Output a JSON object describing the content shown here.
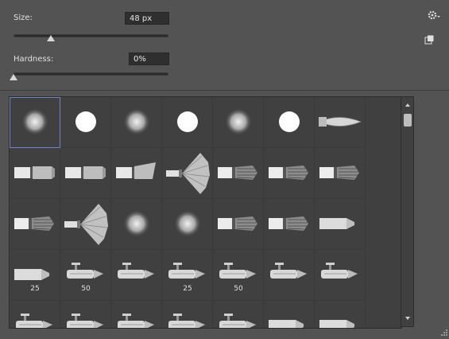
{
  "size": {
    "label": "Size:",
    "value": "48 px",
    "slider_fraction": 0.24
  },
  "hardness": {
    "label": "Hardness:",
    "value": "0%",
    "slider_fraction": 0.0
  },
  "icons": {
    "gear": "gear-icon",
    "new_preset": "new-preset-icon",
    "resize": "resize-grip-icon"
  },
  "presets": [
    {
      "kind": "soft"
    },
    {
      "kind": "hard"
    },
    {
      "kind": "soft"
    },
    {
      "kind": "hard"
    },
    {
      "kind": "soft"
    },
    {
      "kind": "hard"
    },
    {
      "kind": "tip"
    },
    {
      "kind": "flat"
    },
    {
      "kind": "flat"
    },
    {
      "kind": "angle"
    },
    {
      "kind": "fan"
    },
    {
      "kind": "bristle"
    },
    {
      "kind": "bristle"
    },
    {
      "kind": "bristle"
    },
    {
      "kind": "bristle"
    },
    {
      "kind": "fan"
    },
    {
      "kind": "soft"
    },
    {
      "kind": "soft"
    },
    {
      "kind": "bristle"
    },
    {
      "kind": "bristle"
    },
    {
      "kind": "pencil"
    },
    {
      "kind": "pencil",
      "label": "25"
    },
    {
      "kind": "airbrush",
      "label": "50"
    },
    {
      "kind": "airbrush"
    },
    {
      "kind": "airbrush",
      "label": "25"
    },
    {
      "kind": "airbrush",
      "label": "50"
    },
    {
      "kind": "airbrush"
    },
    {
      "kind": "airbrush"
    },
    {
      "kind": "airbrush"
    },
    {
      "kind": "airbrush"
    },
    {
      "kind": "airbrush"
    },
    {
      "kind": "airbrush"
    },
    {
      "kind": "airbrush"
    },
    {
      "kind": "pencil"
    },
    {
      "kind": "pencil"
    }
  ],
  "selected_index": 0
}
